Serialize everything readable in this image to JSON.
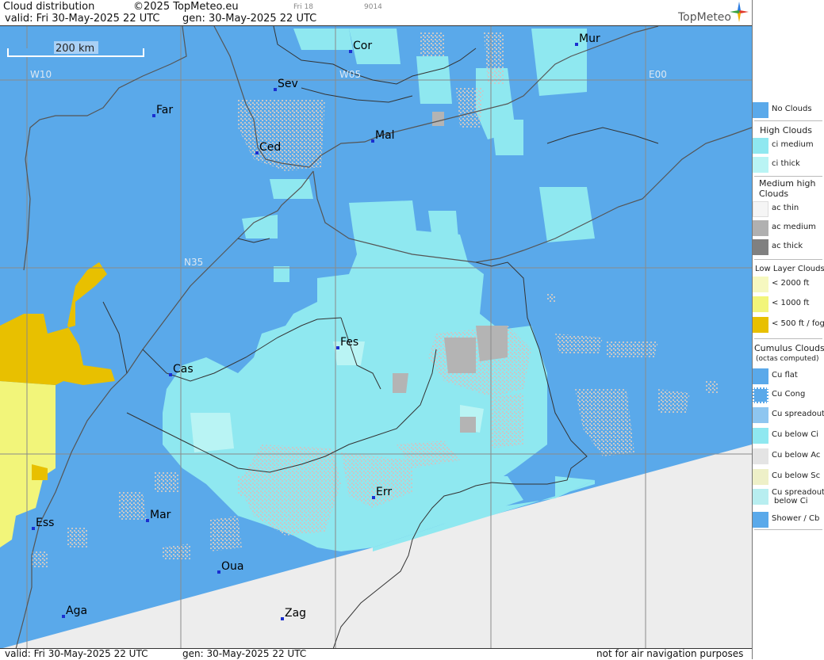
{
  "header": {
    "title": "Cloud distribution",
    "copyright": "©2025 TopMeteo.eu",
    "valid": "valid:  Fri  30-May-2025  22 UTC",
    "generated": "gen: 30-May-2025 22 UTC",
    "day_small": "Fri 18",
    "code_small": "9014",
    "logo": "TopMeteo"
  },
  "map": {
    "scale_label": "200 km",
    "grid_labels": {
      "w10": "W10",
      "w05": "W05",
      "e00": "E00",
      "n35": "N35"
    },
    "cities": {
      "cor": "Cor",
      "mur": "Mur",
      "sev": "Sev",
      "far": "Far",
      "ced": "Ced",
      "mal": "Mal",
      "fes": "Fes",
      "cas": "Cas",
      "err": "Err",
      "mar": "Mar",
      "ess": "Ess",
      "oua": "Oua",
      "aga": "Aga",
      "zag": "Zag"
    },
    "colors": {
      "no_clouds": "#5aa9ea",
      "ci_medium": "#8fe8f0",
      "ci_thick": "#b9f4f4",
      "ac_medium": "#b0b0b0",
      "low_1000": "#f2f57a",
      "fog": "#e8c000",
      "no_data": "#ededed"
    }
  },
  "footer": {
    "valid": "valid:  Fri  30-May-2025  22 UTC",
    "generated": "gen: 30-May-2025 22 UTC",
    "disclaimer": "not for air navigation purposes"
  },
  "legend": {
    "no_clouds": "No Clouds",
    "high_clouds_head": "High Clouds",
    "ci_medium": "ci medium",
    "ci_thick": "ci thick",
    "medium_head_1": "Medium high",
    "medium_head_2": "Clouds",
    "ac_thin": "ac thin",
    "ac_medium": "ac medium",
    "ac_thick": "ac thick",
    "low_head": "Low Layer Clouds",
    "low_2000": "< 2000 ft",
    "low_1000": "< 1000 ft",
    "low_fog": "< 500 ft / fog",
    "cu_head": "Cumulus Clouds",
    "cu_sub": "(octas computed)",
    "cu_flat": "Cu flat",
    "cu_cong": "Cu Cong",
    "cu_spreadout": "Cu spreadout",
    "cu_below_ci": "Cu below Ci",
    "cu_below_ac": "Cu below Ac",
    "cu_below_sc": "Cu below Sc",
    "cu_spreadout_ci_1": "Cu spreadout",
    "cu_spreadout_ci_2": "below Ci",
    "shower": "Shower / Cb"
  }
}
